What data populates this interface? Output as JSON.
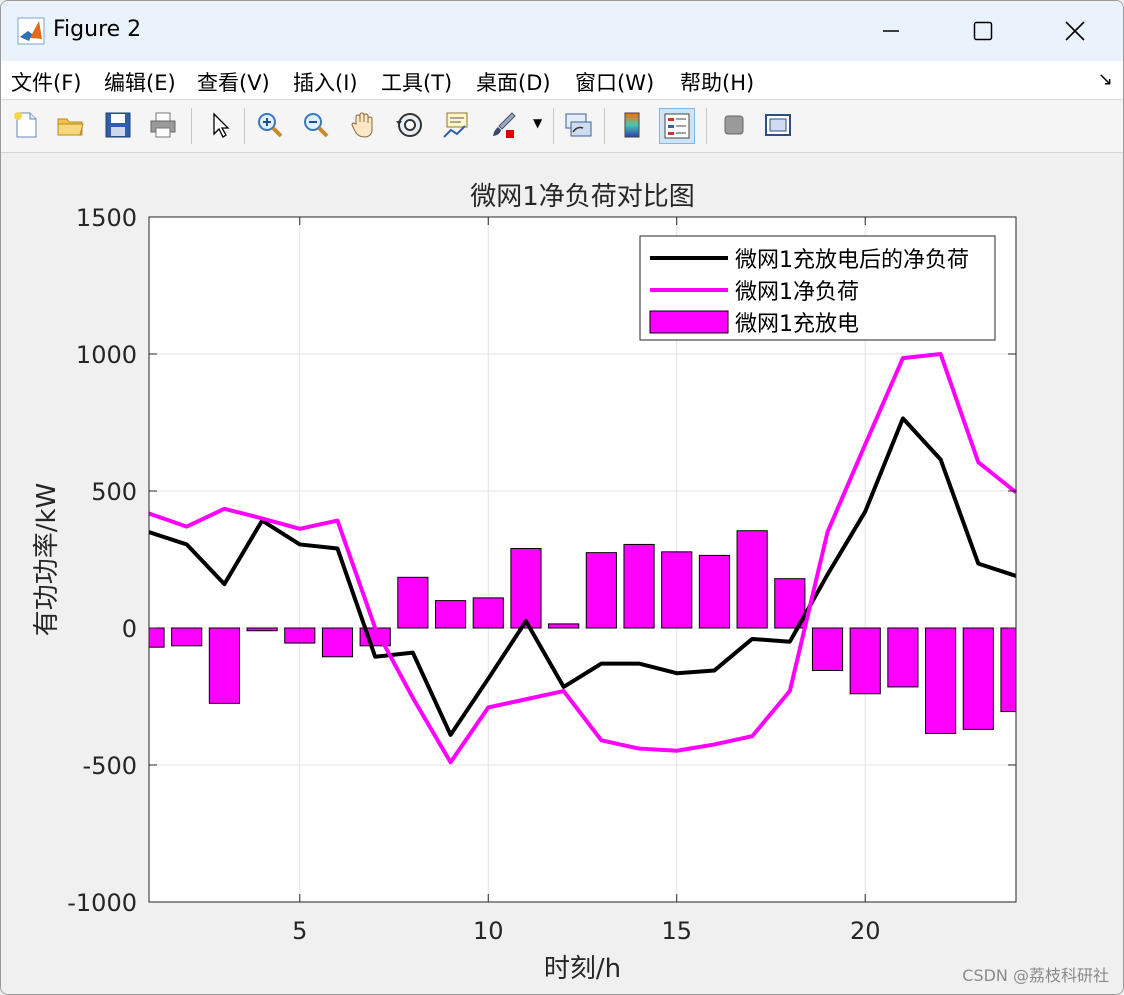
{
  "window": {
    "title": "Figure 2"
  },
  "menu": [
    "文件(F)",
    "编辑(E)",
    "查看(V)",
    "插入(I)",
    "工具(T)",
    "桌面(D)",
    "窗口(W)",
    "帮助(H)"
  ],
  "toolbar": [
    "new-file-icon",
    "open-folder-icon",
    "save-icon",
    "print-icon",
    "pointer-icon",
    "zoom-in-icon",
    "zoom-out-icon",
    "pan-hand-icon",
    "rotate-3d-icon",
    "data-cursor-icon",
    "brush-icon",
    "link-plot-icon",
    "colorbar-icon",
    "legend-icon",
    "hide-plot-tools-icon",
    "show-plot-tools-icon"
  ],
  "chart_data": {
    "type": "bar+line",
    "title": "微网1净负荷对比图",
    "xlabel": "时刻/h",
    "ylabel": "有功功率/kW",
    "xlim": [
      1,
      24
    ],
    "ylim": [
      -1000,
      1500
    ],
    "xticks": [
      5,
      10,
      15,
      20
    ],
    "yticks": [
      -1000,
      -500,
      0,
      500,
      1000,
      1500
    ],
    "grid": true,
    "legend_position": "top-right",
    "x": [
      1,
      2,
      3,
      4,
      5,
      6,
      7,
      8,
      9,
      10,
      11,
      12,
      13,
      14,
      15,
      16,
      17,
      18,
      19,
      20,
      21,
      22,
      23,
      24
    ],
    "series": [
      {
        "name": "微网1充放电后的净负荷",
        "kind": "line",
        "color": "#000000",
        "values": [
          350,
          305,
          160,
          392,
          305,
          290,
          -105,
          -90,
          -390,
          -185,
          25,
          -215,
          -130,
          -130,
          -165,
          -155,
          -40,
          -50,
          195,
          425,
          765,
          615,
          235,
          190
        ]
      },
      {
        "name": "微网1净负荷",
        "kind": "line",
        "color": "#ff00ff",
        "values": [
          418,
          370,
          435,
          400,
          362,
          392,
          0,
          -255,
          -490,
          -290,
          -260,
          -230,
          -410,
          -440,
          -448,
          -425,
          -395,
          -230,
          350,
          670,
          985,
          1000,
          605,
          495
        ]
      },
      {
        "name": "微网1充放电",
        "kind": "bar",
        "color": "#ff00ff",
        "values": [
          -70,
          -65,
          -275,
          -10,
          -55,
          -105,
          -65,
          185,
          100,
          110,
          290,
          15,
          275,
          305,
          278,
          265,
          355,
          180,
          -155,
          -240,
          -215,
          -385,
          -370,
          -305
        ]
      }
    ]
  },
  "watermark": "CSDN @荔枝科研社"
}
